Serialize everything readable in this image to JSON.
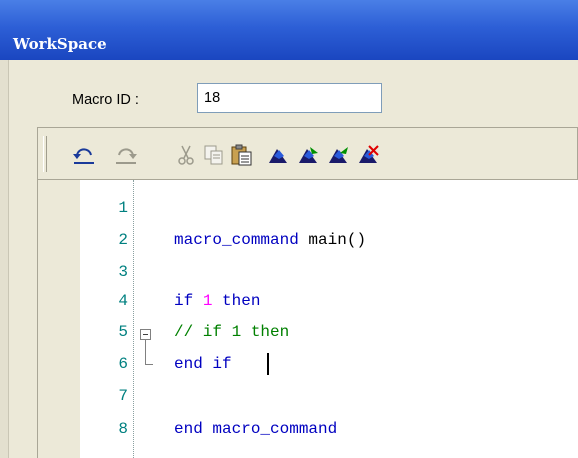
{
  "window": {
    "title": "WorkSpace"
  },
  "macro": {
    "label": "Macro ID :",
    "value": "18"
  },
  "toolbar": {
    "buttons": [
      {
        "name": "undo-icon",
        "enabled": true
      },
      {
        "name": "redo-icon",
        "enabled": false
      },
      {
        "name": "cut-icon",
        "enabled": false
      },
      {
        "name": "copy-icon",
        "enabled": false
      },
      {
        "name": "paste-icon",
        "enabled": true
      },
      {
        "name": "marker-icon",
        "enabled": true
      },
      {
        "name": "marker-next-icon",
        "enabled": true
      },
      {
        "name": "marker-prev-icon",
        "enabled": true
      },
      {
        "name": "marker-clear-icon",
        "enabled": true
      }
    ]
  },
  "editor": {
    "lines": [
      {
        "num": "1",
        "tokens": []
      },
      {
        "num": "2",
        "tokens": [
          {
            "t": "macro_command",
            "c": "kw"
          },
          {
            "t": " main()",
            "c": "plain"
          }
        ]
      },
      {
        "num": "3",
        "tokens": []
      },
      {
        "num": "4",
        "tokens": [
          {
            "t": "if ",
            "c": "kw"
          },
          {
            "t": "1",
            "c": "num"
          },
          {
            "t": " then",
            "c": "kw"
          }
        ]
      },
      {
        "num": "5",
        "tokens": [
          {
            "t": "// if 1 then",
            "c": "cmt"
          }
        ]
      },
      {
        "num": "6",
        "tokens": [
          {
            "t": "end if",
            "c": "kw"
          }
        ]
      },
      {
        "num": "7",
        "tokens": []
      },
      {
        "num": "8",
        "tokens": [
          {
            "t": "end macro_command",
            "c": "kw"
          }
        ]
      }
    ]
  },
  "colors": {
    "keyword": "#0000c0",
    "number": "#ff00ff",
    "comment": "#008000",
    "line_number": "#008080",
    "title_bar": "#2d5fd6"
  }
}
